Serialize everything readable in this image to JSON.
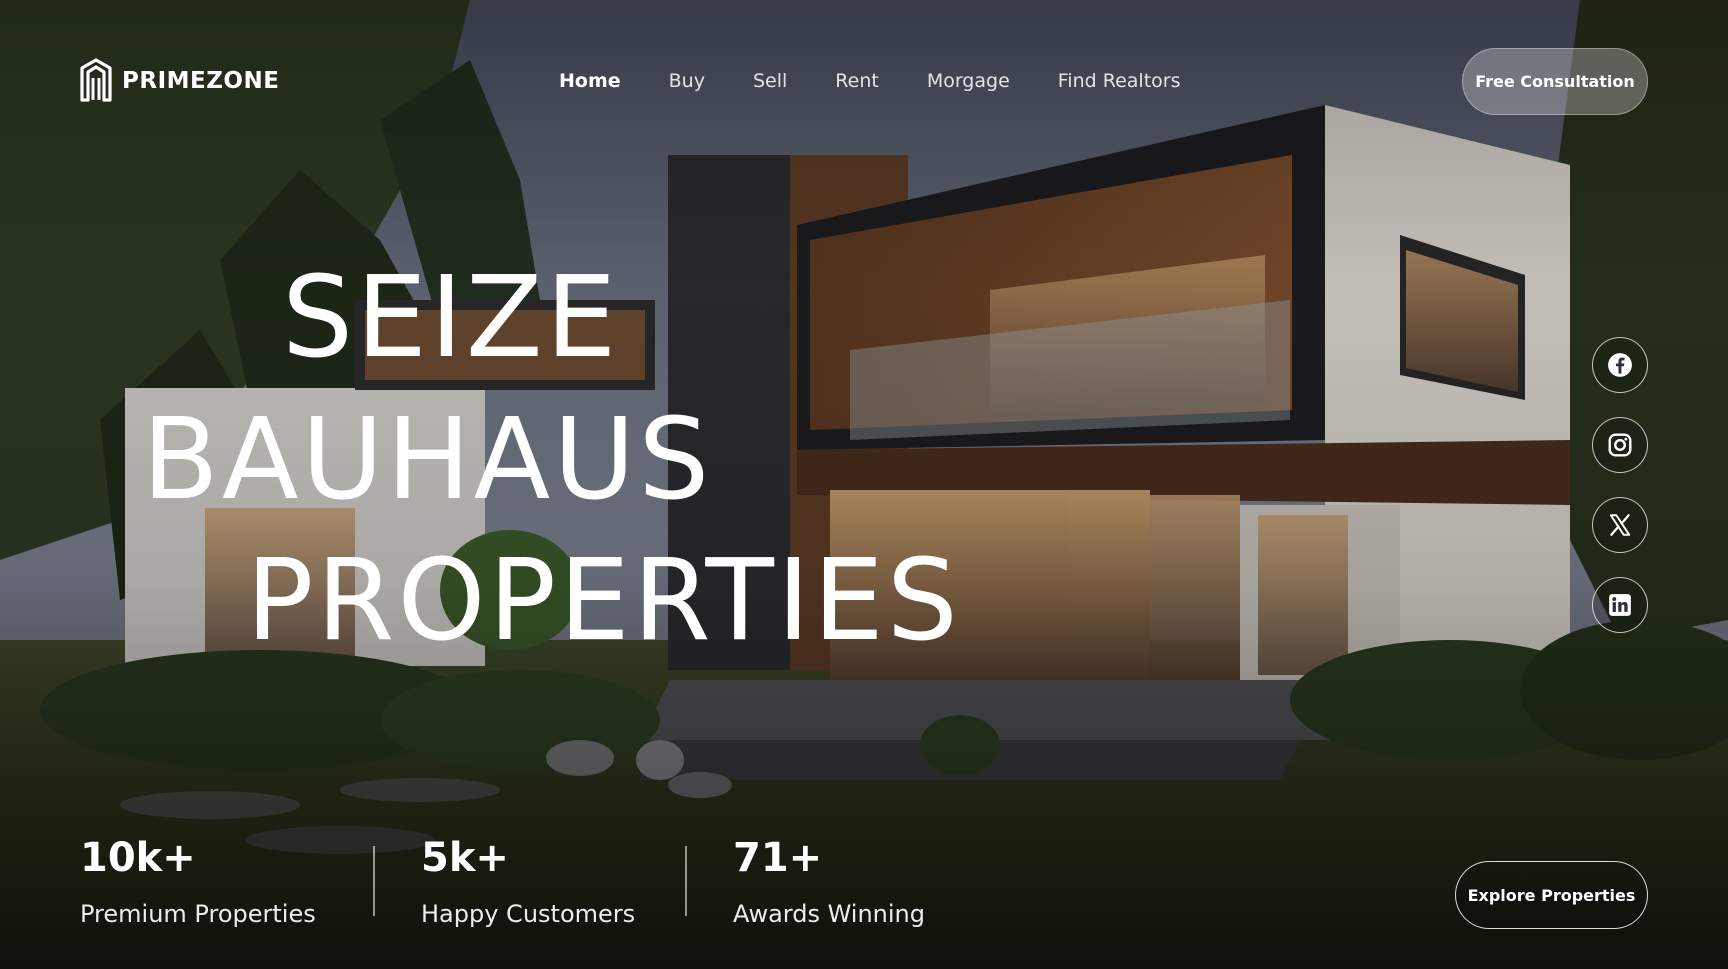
{
  "brand": {
    "name": "PRIMEZONE"
  },
  "nav": {
    "items": [
      {
        "label": "Home",
        "active": true
      },
      {
        "label": "Buy"
      },
      {
        "label": "Sell"
      },
      {
        "label": "Rent"
      },
      {
        "label": "Morgage"
      },
      {
        "label": "Find Realtors"
      }
    ]
  },
  "cta": {
    "consultation": "Free Consultation",
    "explore": "Explore Properties"
  },
  "hero": {
    "lines": [
      "SEIZE",
      "BAUHAUS",
      "PROPERTIES"
    ]
  },
  "social": [
    {
      "icon": "facebook-icon"
    },
    {
      "icon": "instagram-icon"
    },
    {
      "icon": "x-twitter-icon"
    },
    {
      "icon": "linkedin-icon"
    }
  ],
  "stats": [
    {
      "value": "10k+",
      "label": "Premium Properties"
    },
    {
      "value": "5k+",
      "label": "Happy Customers"
    },
    {
      "value": "71+",
      "label": "Awards Winning"
    }
  ]
}
